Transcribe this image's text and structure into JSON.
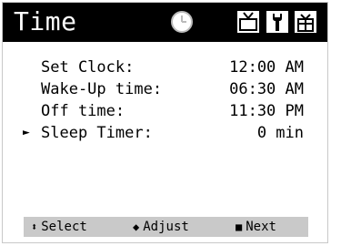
{
  "header": {
    "title": "Time",
    "icons": [
      "clock-icon",
      "tv-icon",
      "wrench-icon",
      "gift-icon"
    ]
  },
  "settings": [
    {
      "label": "Set Clock:",
      "value": "12:00 AM",
      "selected": false
    },
    {
      "label": "Wake-Up time:",
      "value": "06:30 AM",
      "selected": false
    },
    {
      "label": "Off time:",
      "value": "11:30 PM",
      "selected": false
    },
    {
      "label": "Sleep Timer:",
      "value": "0 min",
      "selected": true
    }
  ],
  "pointer_glyph": "►",
  "footer": {
    "select_glyph": "⬍",
    "select_label": "Select",
    "adjust_glyph": "◆",
    "adjust_label": "Adjust",
    "next_glyph": "■",
    "next_label": "Next"
  },
  "colors": {
    "title_bar": "#000000",
    "title_text": "#ffffff",
    "footer_bg": "#c9c9c9",
    "text": "#000000"
  }
}
